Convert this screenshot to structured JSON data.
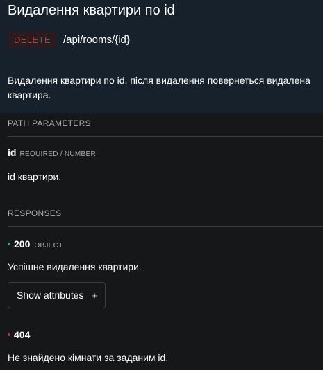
{
  "header": {
    "title": "Видалення квартири по id",
    "method": "DELETE",
    "path": "/api/rooms/{id}",
    "description": "Видалення квартири по id, після видалення повернеться видалена квартира."
  },
  "path_parameters": {
    "section_label": "PATH PARAMETERS",
    "params": [
      {
        "name": "id",
        "meta": "REQUIRED / NUMBER",
        "description": "id квартири."
      }
    ]
  },
  "responses": {
    "section_label": "RESPONSES",
    "items": [
      {
        "code": "200",
        "type": "OBJECT",
        "description": "Успішне видалення квартири.",
        "status_color": "#2e9b6b",
        "button_label": "Show attributes",
        "button_icon": "+"
      },
      {
        "code": "404",
        "type": "",
        "description": "Не знайдено кімнати за заданим id.",
        "status_color": "#c8313b"
      }
    ]
  },
  "colors": {
    "header_bg": "#17212b",
    "page_bg": "#161719",
    "method_text": "#c8313b",
    "method_bg": "#2a1b1f"
  }
}
